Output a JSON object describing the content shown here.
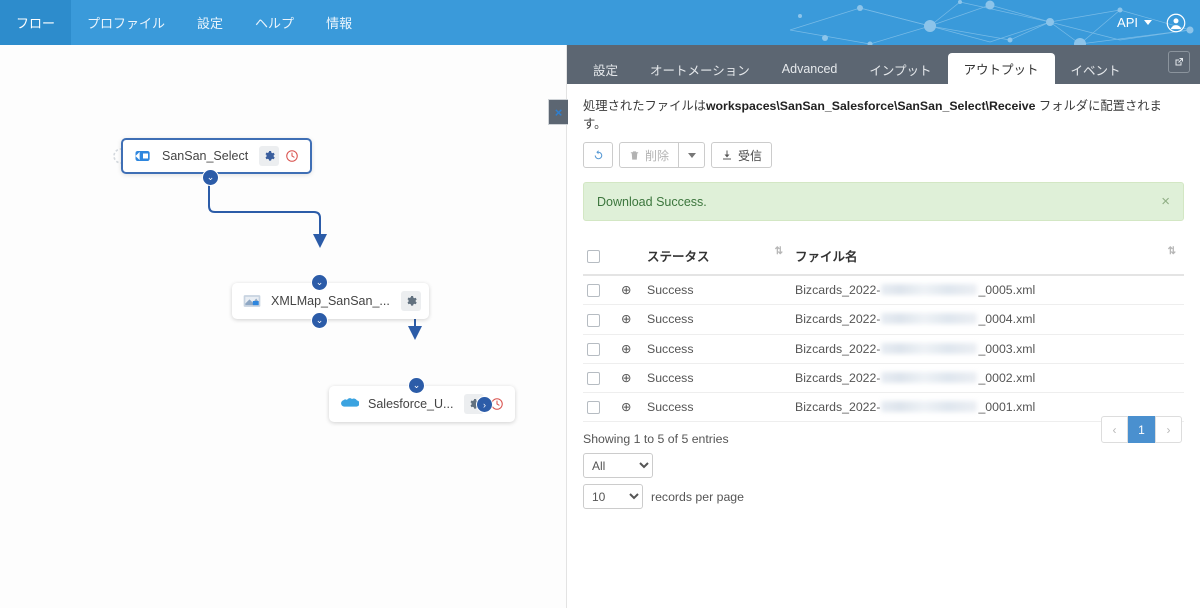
{
  "topnav": {
    "items": [
      {
        "label": "フロー",
        "active": true
      },
      {
        "label": "プロファイル",
        "active": false
      },
      {
        "label": "設定",
        "active": false
      },
      {
        "label": "ヘルプ",
        "active": false
      },
      {
        "label": "情報",
        "active": false
      }
    ],
    "api_label": "API",
    "avatar_icon": "user-circle-icon",
    "background_color": "#3a9ada"
  },
  "canvas": {
    "collapse_label": "×",
    "nodes": [
      {
        "label": "SanSan_Select",
        "icon": "flow-source-icon",
        "settings_icon": "gear-icon",
        "status_icon": "disable-clock-icon"
      },
      {
        "label": "XMLMap_SanSan_...",
        "icon": "xml-map-icon",
        "settings_icon": "gear-icon"
      },
      {
        "label": "Salesforce_U...",
        "icon": "salesforce-cloud-icon",
        "settings_icon": "gear-icon",
        "status_icon": "disable-clock-icon"
      }
    ]
  },
  "panel": {
    "tabs": [
      {
        "label": "設定",
        "active": false
      },
      {
        "label": "オートメーション",
        "active": false
      },
      {
        "label": "Advanced",
        "active": false
      },
      {
        "label": "インプット",
        "active": false
      },
      {
        "label": "アウトプット",
        "active": true
      },
      {
        "label": "イベント",
        "active": false
      }
    ],
    "external_link_icon": "external-link-icon",
    "description": {
      "prefix": "処理されたファイルは",
      "path": "workspaces\\SanSan_Salesforce\\SanSan_Select\\Receive",
      "suffix": " フォルダに配置されます。"
    },
    "toolbar": {
      "refresh_icon": "refresh-icon",
      "delete_label": "削除",
      "delete_icon": "trash-icon",
      "dropdown_caret": "caret-down-icon",
      "receive_label": "受信",
      "receive_icon": "download-icon"
    },
    "alert": {
      "message": "Download Success.",
      "close_label": "×",
      "background_color": "#dff0d8",
      "text_color": "#3c763d"
    },
    "table": {
      "columns": [
        "",
        "",
        "ステータス",
        "ファイル名"
      ],
      "header_status": "ステータス",
      "header_filename": "ファイル名",
      "rows": [
        {
          "status": "Success",
          "file_prefix": "Bizcards_2022-",
          "file_suffix": "_0005.xml"
        },
        {
          "status": "Success",
          "file_prefix": "Bizcards_2022-",
          "file_suffix": "_0004.xml"
        },
        {
          "status": "Success",
          "file_prefix": "Bizcards_2022-",
          "file_suffix": "_0003.xml"
        },
        {
          "status": "Success",
          "file_prefix": "Bizcards_2022-",
          "file_suffix": "_0002.xml"
        },
        {
          "status": "Success",
          "file_prefix": "Bizcards_2022-",
          "file_suffix": "_0001.xml"
        }
      ]
    },
    "footer": {
      "showing": "Showing 1 to 5 of 5 entries",
      "filter_value": "All",
      "filter_options": [
        "All"
      ],
      "records_value": "10",
      "records_options": [
        "10"
      ],
      "records_label": "records per page"
    },
    "pagination": {
      "prev": "‹",
      "pages": [
        "1"
      ],
      "next": "›",
      "active_color": "#4a90cf"
    }
  }
}
